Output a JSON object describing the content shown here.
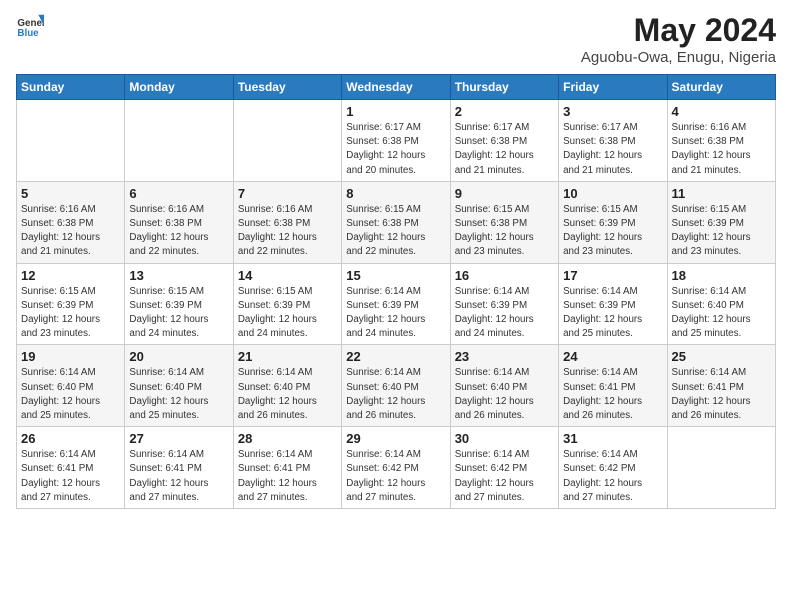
{
  "logo": {
    "general": "General",
    "blue": "Blue"
  },
  "title": "May 2024",
  "subtitle": "Aguobu-Owa, Enugu, Nigeria",
  "days_of_week": [
    "Sunday",
    "Monday",
    "Tuesday",
    "Wednesday",
    "Thursday",
    "Friday",
    "Saturday"
  ],
  "weeks": [
    [
      {
        "num": "",
        "info": ""
      },
      {
        "num": "",
        "info": ""
      },
      {
        "num": "",
        "info": ""
      },
      {
        "num": "1",
        "info": "Sunrise: 6:17 AM\nSunset: 6:38 PM\nDaylight: 12 hours\nand 20 minutes."
      },
      {
        "num": "2",
        "info": "Sunrise: 6:17 AM\nSunset: 6:38 PM\nDaylight: 12 hours\nand 21 minutes."
      },
      {
        "num": "3",
        "info": "Sunrise: 6:17 AM\nSunset: 6:38 PM\nDaylight: 12 hours\nand 21 minutes."
      },
      {
        "num": "4",
        "info": "Sunrise: 6:16 AM\nSunset: 6:38 PM\nDaylight: 12 hours\nand 21 minutes."
      }
    ],
    [
      {
        "num": "5",
        "info": "Sunrise: 6:16 AM\nSunset: 6:38 PM\nDaylight: 12 hours\nand 21 minutes."
      },
      {
        "num": "6",
        "info": "Sunrise: 6:16 AM\nSunset: 6:38 PM\nDaylight: 12 hours\nand 22 minutes."
      },
      {
        "num": "7",
        "info": "Sunrise: 6:16 AM\nSunset: 6:38 PM\nDaylight: 12 hours\nand 22 minutes."
      },
      {
        "num": "8",
        "info": "Sunrise: 6:15 AM\nSunset: 6:38 PM\nDaylight: 12 hours\nand 22 minutes."
      },
      {
        "num": "9",
        "info": "Sunrise: 6:15 AM\nSunset: 6:38 PM\nDaylight: 12 hours\nand 23 minutes."
      },
      {
        "num": "10",
        "info": "Sunrise: 6:15 AM\nSunset: 6:39 PM\nDaylight: 12 hours\nand 23 minutes."
      },
      {
        "num": "11",
        "info": "Sunrise: 6:15 AM\nSunset: 6:39 PM\nDaylight: 12 hours\nand 23 minutes."
      }
    ],
    [
      {
        "num": "12",
        "info": "Sunrise: 6:15 AM\nSunset: 6:39 PM\nDaylight: 12 hours\nand 23 minutes."
      },
      {
        "num": "13",
        "info": "Sunrise: 6:15 AM\nSunset: 6:39 PM\nDaylight: 12 hours\nand 24 minutes."
      },
      {
        "num": "14",
        "info": "Sunrise: 6:15 AM\nSunset: 6:39 PM\nDaylight: 12 hours\nand 24 minutes."
      },
      {
        "num": "15",
        "info": "Sunrise: 6:14 AM\nSunset: 6:39 PM\nDaylight: 12 hours\nand 24 minutes."
      },
      {
        "num": "16",
        "info": "Sunrise: 6:14 AM\nSunset: 6:39 PM\nDaylight: 12 hours\nand 24 minutes."
      },
      {
        "num": "17",
        "info": "Sunrise: 6:14 AM\nSunset: 6:39 PM\nDaylight: 12 hours\nand 25 minutes."
      },
      {
        "num": "18",
        "info": "Sunrise: 6:14 AM\nSunset: 6:40 PM\nDaylight: 12 hours\nand 25 minutes."
      }
    ],
    [
      {
        "num": "19",
        "info": "Sunrise: 6:14 AM\nSunset: 6:40 PM\nDaylight: 12 hours\nand 25 minutes."
      },
      {
        "num": "20",
        "info": "Sunrise: 6:14 AM\nSunset: 6:40 PM\nDaylight: 12 hours\nand 25 minutes."
      },
      {
        "num": "21",
        "info": "Sunrise: 6:14 AM\nSunset: 6:40 PM\nDaylight: 12 hours\nand 26 minutes."
      },
      {
        "num": "22",
        "info": "Sunrise: 6:14 AM\nSunset: 6:40 PM\nDaylight: 12 hours\nand 26 minutes."
      },
      {
        "num": "23",
        "info": "Sunrise: 6:14 AM\nSunset: 6:40 PM\nDaylight: 12 hours\nand 26 minutes."
      },
      {
        "num": "24",
        "info": "Sunrise: 6:14 AM\nSunset: 6:41 PM\nDaylight: 12 hours\nand 26 minutes."
      },
      {
        "num": "25",
        "info": "Sunrise: 6:14 AM\nSunset: 6:41 PM\nDaylight: 12 hours\nand 26 minutes."
      }
    ],
    [
      {
        "num": "26",
        "info": "Sunrise: 6:14 AM\nSunset: 6:41 PM\nDaylight: 12 hours\nand 27 minutes."
      },
      {
        "num": "27",
        "info": "Sunrise: 6:14 AM\nSunset: 6:41 PM\nDaylight: 12 hours\nand 27 minutes."
      },
      {
        "num": "28",
        "info": "Sunrise: 6:14 AM\nSunset: 6:41 PM\nDaylight: 12 hours\nand 27 minutes."
      },
      {
        "num": "29",
        "info": "Sunrise: 6:14 AM\nSunset: 6:42 PM\nDaylight: 12 hours\nand 27 minutes."
      },
      {
        "num": "30",
        "info": "Sunrise: 6:14 AM\nSunset: 6:42 PM\nDaylight: 12 hours\nand 27 minutes."
      },
      {
        "num": "31",
        "info": "Sunrise: 6:14 AM\nSunset: 6:42 PM\nDaylight: 12 hours\nand 27 minutes."
      },
      {
        "num": "",
        "info": ""
      }
    ]
  ]
}
